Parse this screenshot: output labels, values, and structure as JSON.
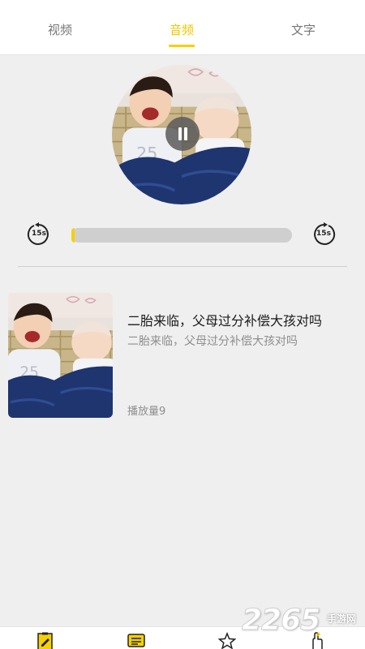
{
  "tabs": [
    {
      "label": "视频",
      "active": false
    },
    {
      "label": "音频",
      "active": true
    },
    {
      "label": "文字",
      "active": false
    }
  ],
  "colors": {
    "accent": "#f5d100",
    "background": "#efefef",
    "progress_track": "#cfcfcf"
  },
  "player": {
    "cover_image": "babies-photo",
    "state_icon": "pause-icon",
    "rewind_label": "15s",
    "forward_label": "15s",
    "progress_fraction": 0.01
  },
  "item": {
    "title": "二胎来临，父母过分补偿大孩对吗",
    "subtitle": "二胎来临，父母过分补偿大孩对吗",
    "plays": "播放量9",
    "thumbnail": "babies-photo"
  },
  "bottom_nav": [
    {
      "icon": "clipboard-edit-icon"
    },
    {
      "icon": "chat-list-icon"
    },
    {
      "icon": "star-icon"
    },
    {
      "icon": "hand-icon"
    }
  ],
  "watermark": {
    "number": "2265",
    "site": "手游网"
  }
}
